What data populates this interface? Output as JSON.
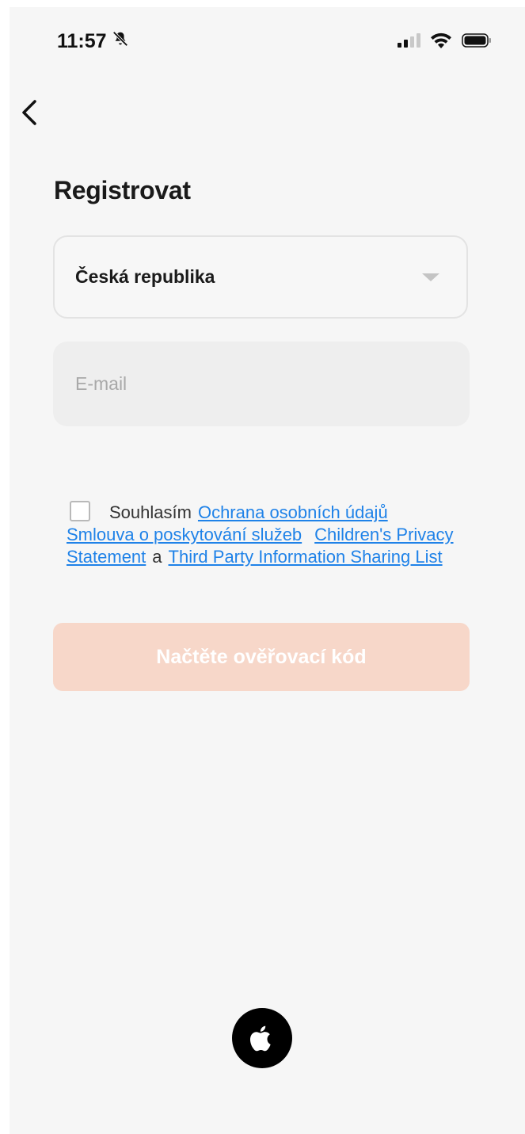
{
  "status_bar": {
    "time": "11:57",
    "icons": [
      "bell-slash-icon",
      "signal-icon",
      "wifi-icon",
      "battery-icon"
    ]
  },
  "nav": {
    "back_icon": "chevron-left-icon"
  },
  "title": "Registrovat",
  "country_select": {
    "value": "Česká republika",
    "icon": "caret-down-icon"
  },
  "email": {
    "placeholder": "E-mail",
    "value": ""
  },
  "consent": {
    "checked": false,
    "prefix": "Souhlasím",
    "privacy_link": "Ochrana osobních údajů",
    "service_link": "Smlouva o poskytování služeb",
    "children_link": "Children's Privacy Statement",
    "conjunction": "a",
    "third_party_link": "Third Party Information Sharing List"
  },
  "submit": {
    "label": "Načtěte ověřovací kód",
    "disabled": true
  },
  "social_login": {
    "icon": "apple-icon"
  },
  "colors": {
    "accent": "#f7d7c9",
    "link": "#1f82e8",
    "background": "#f6f6f6"
  }
}
